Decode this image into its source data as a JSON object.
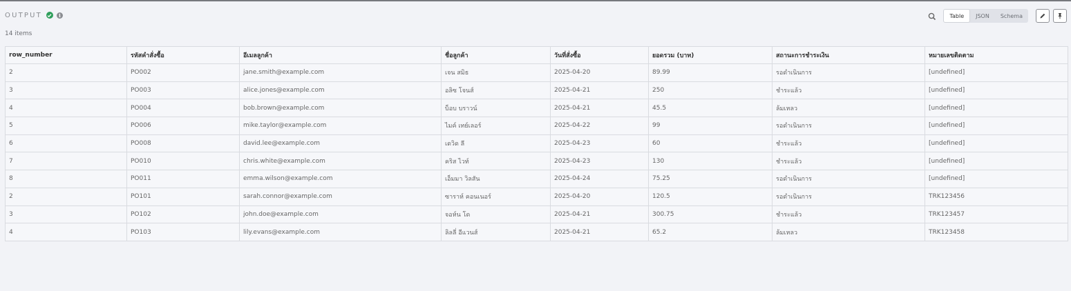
{
  "panel": {
    "title": "OUTPUT",
    "item_count": "14 items"
  },
  "toolbar": {
    "view_modes": [
      {
        "label": "Table",
        "active": true
      },
      {
        "label": "JSON",
        "active": false
      },
      {
        "label": "Schema",
        "active": false
      }
    ]
  },
  "colors": {
    "success": "#2f9e5b",
    "undefined_text": "#e0343e"
  },
  "table": {
    "columns": [
      "row_number",
      "รหัสคำสั่งซื้อ",
      "อีเมลลูกค้า",
      "ชื่อลูกค้า",
      "วันที่สั่งซื้อ",
      "ยอดรวม (บาท)",
      "สถานะการชำระเงิน",
      "หมายเลขติดตาม"
    ],
    "rows": [
      [
        "2",
        "PO002",
        "jane.smith@example.com",
        "เจน สมิธ",
        "2025-04-20",
        "89.99",
        "รอดำเนินการ",
        "[undefined]"
      ],
      [
        "3",
        "PO003",
        "alice.jones@example.com",
        "อลิซ โจนส์",
        "2025-04-21",
        "250",
        "ชำระแล้ว",
        "[undefined]"
      ],
      [
        "4",
        "PO004",
        "bob.brown@example.com",
        "บ็อบ บราวน์",
        "2025-04-21",
        "45.5",
        "ล้มเหลว",
        "[undefined]"
      ],
      [
        "5",
        "PO006",
        "mike.taylor@example.com",
        "ไมค์ เทย์เลอร์",
        "2025-04-22",
        "99",
        "รอดำเนินการ",
        "[undefined]"
      ],
      [
        "6",
        "PO008",
        "david.lee@example.com",
        "เดวิด ลี",
        "2025-04-23",
        "60",
        "ชำระแล้ว",
        "[undefined]"
      ],
      [
        "7",
        "PO010",
        "chris.white@example.com",
        "คริส ไวท์",
        "2025-04-23",
        "130",
        "ชำระแล้ว",
        "[undefined]"
      ],
      [
        "8",
        "PO011",
        "emma.wilson@example.com",
        "เอ็มมา วิลสัน",
        "2025-04-24",
        "75.25",
        "รอดำเนินการ",
        "[undefined]"
      ],
      [
        "2",
        "PO101",
        "sarah.connor@example.com",
        "ซาราห์ คอนเนอร์",
        "2025-04-20",
        "120.5",
        "รอดำเนินการ",
        "TRK123456"
      ],
      [
        "3",
        "PO102",
        "john.doe@example.com",
        "จอห์น โด",
        "2025-04-21",
        "300.75",
        "ชำระแล้ว",
        "TRK123457"
      ],
      [
        "4",
        "PO103",
        "lily.evans@example.com",
        "ลิลลี่ อีแวนส์",
        "2025-04-21",
        "65.2",
        "ล้มเหลว",
        "TRK123458"
      ]
    ]
  }
}
